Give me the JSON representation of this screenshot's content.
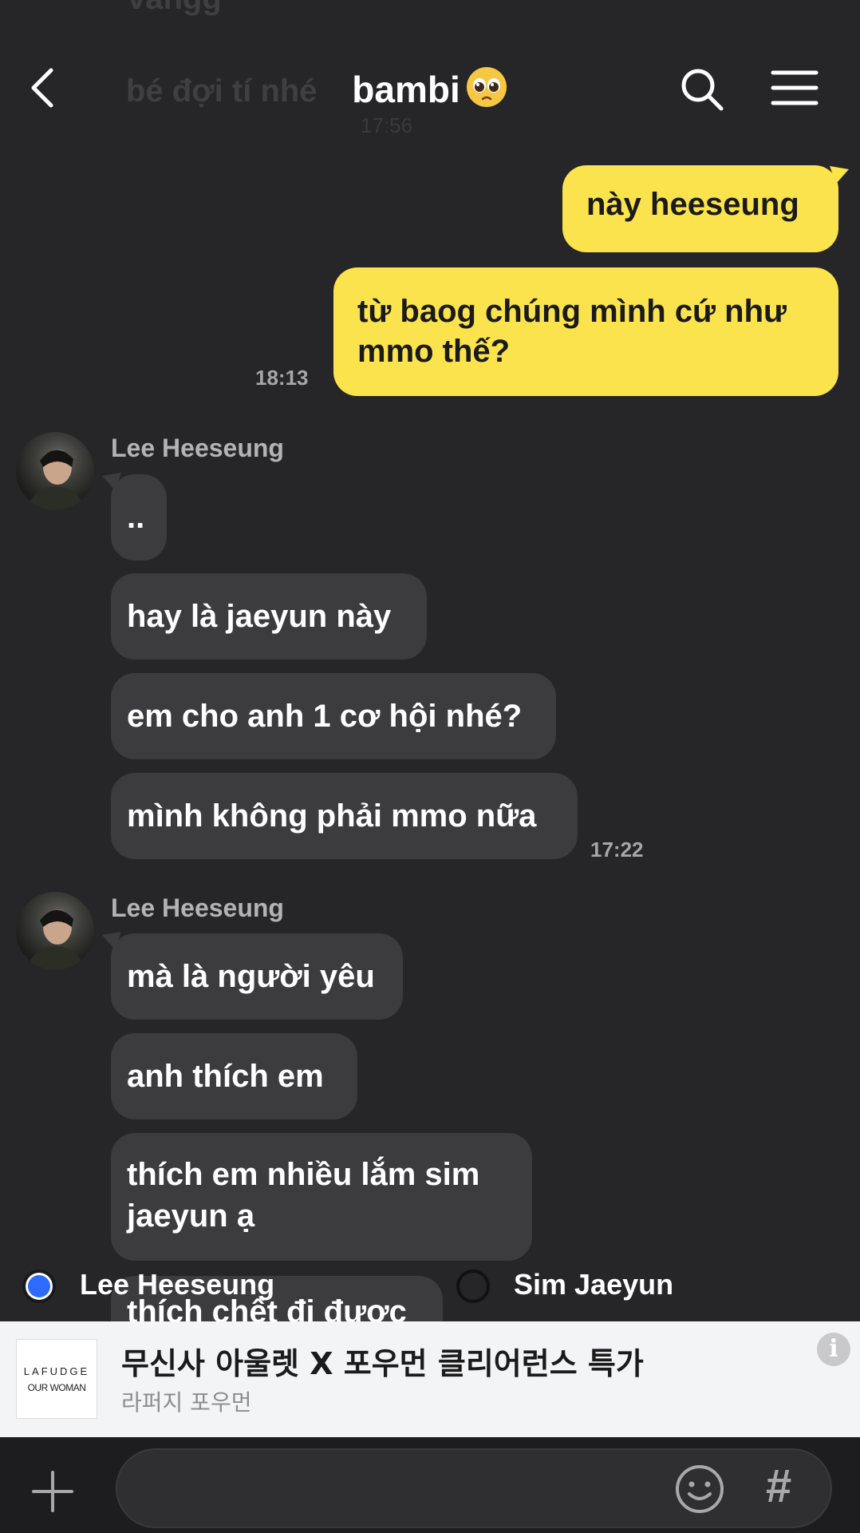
{
  "background_messages": {
    "top_fragment": "vangg",
    "preview_text": "bé đợi tí nhé",
    "preview_time": "17:56"
  },
  "header": {
    "title": "bambi",
    "title_emoji": "pleading-face",
    "back_icon": "chevron-left-icon",
    "search_icon": "search-icon",
    "menu_icon": "hamburger-menu-icon"
  },
  "outgoing": [
    {
      "text": "này heeseung"
    },
    {
      "text": "từ baog chúng mình cứ như mmo thế?",
      "time": "18:13"
    }
  ],
  "groups": [
    {
      "sender": "Lee Heeseung",
      "messages": [
        "..",
        "hay là jaeyun này",
        "em cho anh 1 cơ hội nhé?",
        "mình không phải mmo nữa"
      ],
      "time": "17:22"
    },
    {
      "sender": "Lee Heeseung",
      "messages": [
        "mà là người yêu",
        "anh thích em",
        "thích em nhiều lắm sim jaeyun ạ",
        "thích chết đi được"
      ]
    }
  ],
  "poll": {
    "options": [
      {
        "label": "Lee Heeseung",
        "selected": true
      },
      {
        "label": "Sim Jaeyun",
        "selected": false
      }
    ]
  },
  "ad": {
    "logo_line1": "LAFUDGE",
    "logo_line2": "OUR WOMAN",
    "title": "무신사 아울렛 X 포우먼 클리어런스 특가",
    "subtitle": "라퍼지 포우먼",
    "info_icon": "info-icon"
  },
  "input_bar": {
    "plus_icon": "plus-icon",
    "emoji_icon": "smile-icon",
    "hash_label": "#"
  },
  "colors": {
    "background": "#262628",
    "my_bubble": "#fae34c",
    "their_bubble": "#3c3c3f",
    "selected_radio": "#2d6bff"
  }
}
